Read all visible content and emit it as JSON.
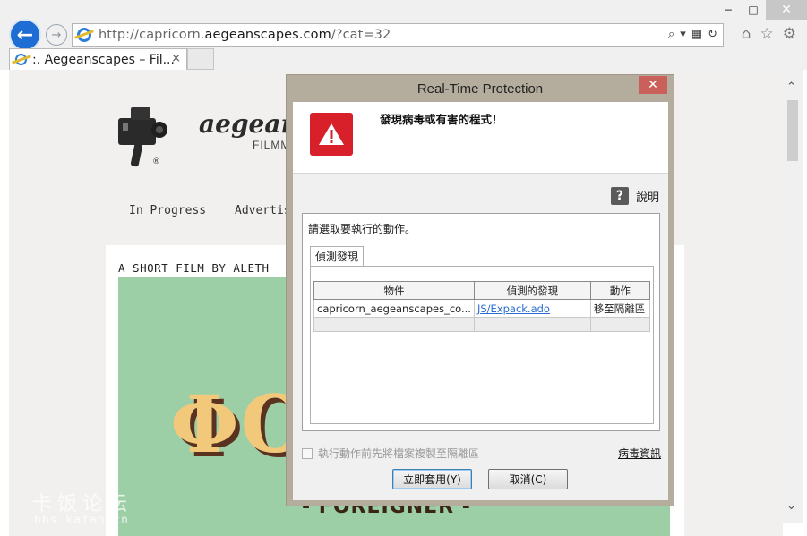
{
  "browser": {
    "url_prefix": "http://capricorn.",
    "url_host": "aegeanscapes.com",
    "url_suffix": "/?cat=32",
    "tab_title": ":. Aegeanscapes – Fil...",
    "tab_close": "×",
    "window_controls": {
      "minimize": "−",
      "maximize": "□",
      "close": "✕"
    },
    "icons": [
      "back-arrow-icon",
      "forward-arrow-icon",
      "ie-logo-icon",
      "search-icon",
      "compat-icon",
      "refresh-icon",
      "home-icon",
      "favorites-star-icon",
      "settings-gear-icon"
    ]
  },
  "page": {
    "brand": "aegear",
    "brand_sub": "FILMM",
    "registered": "®",
    "nav": [
      "In Progress",
      "Advertis"
    ],
    "byline": "A SHORT FILM BY ALETH",
    "poster_title": "ΦΟ",
    "poster_sub": "- FOREIGNER -"
  },
  "watermark": {
    "line1": "卡饭论坛",
    "line2": "bbs.kafan.cn"
  },
  "dialog": {
    "title": "Real-Time Protection",
    "close": "✕",
    "alert": "發現病毒或有害的程式！",
    "help": "說明",
    "prompt": "請選取要執行的動作。",
    "tab": "偵測發現",
    "columns": [
      "物件",
      "偵測的發現",
      "動作"
    ],
    "rows": [
      {
        "object": "capricorn_aegeanscapes_co...",
        "detection": "JS/Expack.ado",
        "action": "移至隔離區"
      }
    ],
    "copy_option": "執行動作前先將檔案複製至隔離區",
    "virus_info": "病毒資訊",
    "apply_button": "立即套用(Y)",
    "cancel_button": "取消(C)"
  },
  "colors": {
    "accent_blue": "#1e6dd5",
    "warning_red": "#d8202b",
    "dialog_frame": "#b4ac9c",
    "poster_green": "#9ccfa6"
  }
}
